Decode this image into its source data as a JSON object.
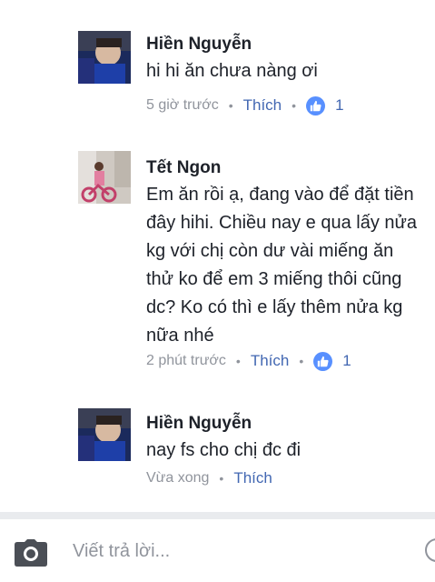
{
  "comments": [
    {
      "author": "Hiền Nguyễn",
      "lines": [
        "hi hi ăn chưa nàng ơi"
      ],
      "time": "5 giờ trước",
      "like_label": "Thích",
      "like_count": "1",
      "avatar_icon": "user-photo-child"
    },
    {
      "author": "Tết Ngon",
      "lines": [
        "Em ăn rồi ạ, đang vào để đặt tiền",
        "đây hihi. Chiều nay e qua lấy nửa",
        "kg với chị còn dư vài miếng ăn",
        "thử ko để em 3 miếng thôi cũng",
        "dc? Ko có thì e lấy thêm nửa kg",
        "nữa nhé"
      ],
      "time": "2 phút trước",
      "like_label": "Thích",
      "like_count": "1",
      "avatar_icon": "user-photo-bicycle"
    },
    {
      "author": "Hiền Nguyễn",
      "lines": [
        "nay fs cho chị đc đi"
      ],
      "time": "Vừa xong",
      "like_label": "Thích",
      "avatar_icon": "user-photo-child"
    }
  ],
  "composer": {
    "placeholder": "Viết trả lời...",
    "camera_icon": "camera-icon",
    "sticker_icon": "sticker-icon"
  },
  "colors": {
    "link": "#4267b2",
    "like_badge": "#5890ff",
    "meta": "#90949c",
    "divider": "#e9ebee"
  }
}
